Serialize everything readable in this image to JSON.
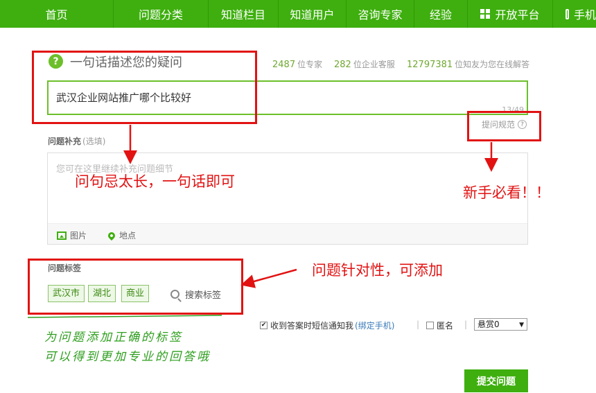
{
  "nav": {
    "items": [
      {
        "label": "首页"
      },
      {
        "label": "问题分类"
      },
      {
        "label": "知道栏目"
      },
      {
        "label": "知道用户"
      },
      {
        "label": "咨询专家"
      },
      {
        "label": "经验"
      },
      {
        "label": "开放平台",
        "icon": "grid-icon"
      },
      {
        "label": "手机",
        "icon": "phone-icon"
      }
    ]
  },
  "ask": {
    "title": "一句话描述您的疑问",
    "stats": [
      {
        "number": "2487",
        "text": "位专家"
      },
      {
        "number": "282",
        "text": "位企业客服"
      },
      {
        "number": "12797381",
        "text": "位知友为您在线解答"
      }
    ],
    "question_value": "武汉企业网站推广哪个比较好",
    "char_count": "13/49",
    "rules_link": "提问规范"
  },
  "supplement": {
    "label": "问题补充",
    "optional": "(选填)",
    "placeholder": "您可在这里继续补充问题细节",
    "image_label": "图片",
    "location_label": "地点"
  },
  "tags": {
    "label": "问题标签",
    "items": [
      "武汉市",
      "湖北",
      "商业"
    ],
    "search_label": "搜索标签"
  },
  "options": {
    "sms_label": "收到答案时短信通知我",
    "bind_phone": "(绑定手机)",
    "separator": "|",
    "anonymous_label": "匿名",
    "reward_value": "悬赏0"
  },
  "submit_label": "提交问题",
  "annotations": {
    "too_long": "问句忌太长，一句话即可",
    "newbie": "新手必看！！",
    "tags_note": "问题针对性，可添加",
    "green_line1": "为问题添加正确的标签",
    "green_line2": "可以得到更加专业的回答哦"
  },
  "colors": {
    "brand_green": "#3eaf0e",
    "annotation_red": "#e21212",
    "annotation_green": "#2e9e1e"
  }
}
